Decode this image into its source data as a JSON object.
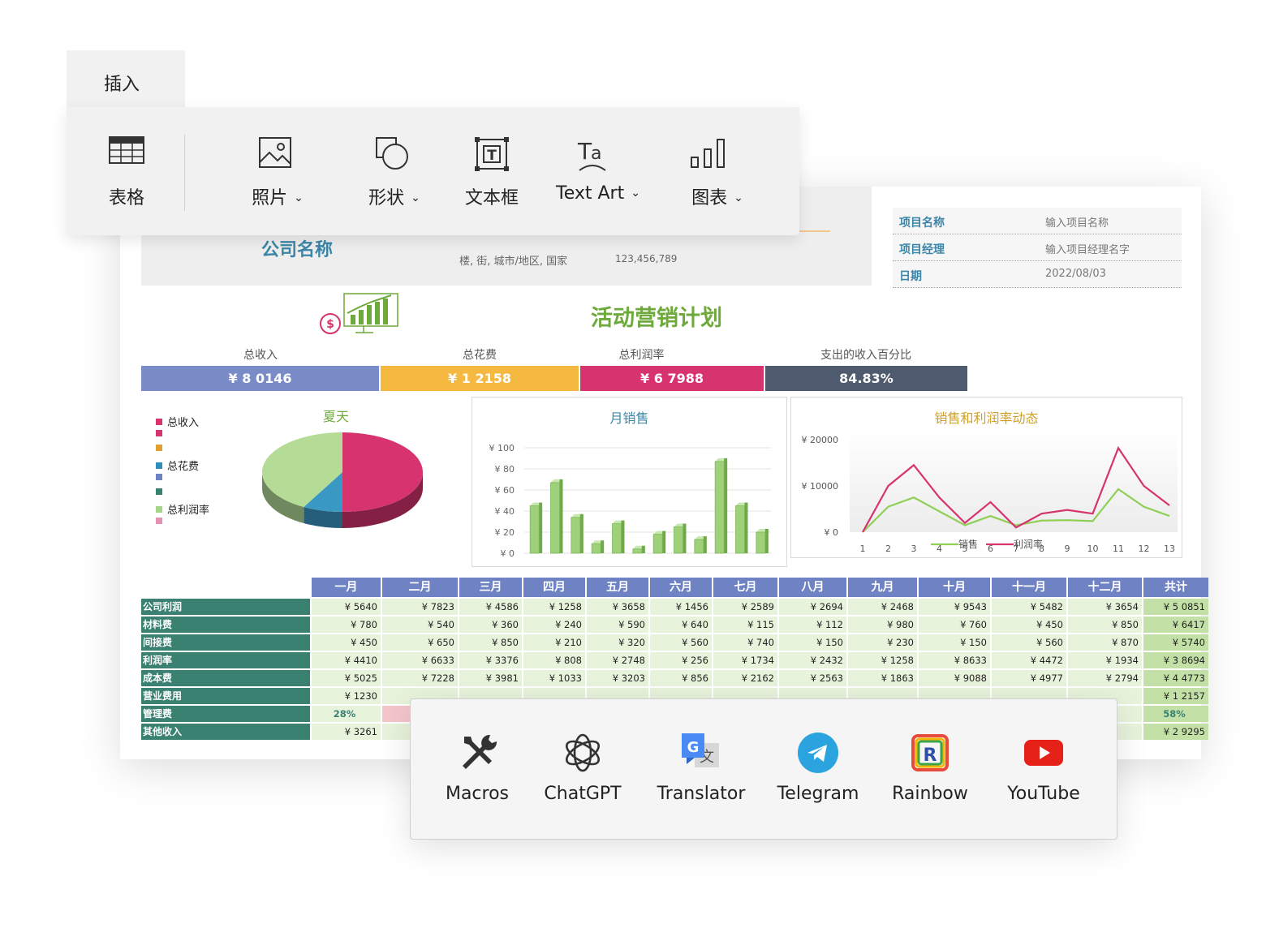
{
  "ribbon": {
    "tab": "插入",
    "tools": [
      {
        "label": "表格",
        "icon": "table-icon",
        "dropdown": false
      },
      {
        "label": "照片",
        "icon": "picture-icon",
        "dropdown": true
      },
      {
        "label": "形状",
        "icon": "shapes-icon",
        "dropdown": true
      },
      {
        "label": "文本框",
        "icon": "textbox-icon",
        "dropdown": false
      },
      {
        "label": "Text Art",
        "icon": "text-art-icon",
        "dropdown": true
      },
      {
        "label": "图表",
        "icon": "chart-icon",
        "dropdown": true
      }
    ],
    "caret": "⌄"
  },
  "sheet": {
    "company": "公司名称",
    "address": "楼, 街, 城市/地区, 国家",
    "phone": "123,456,789",
    "info": [
      {
        "key": "项目名称",
        "value": "输入项目名称"
      },
      {
        "key": "项目经理",
        "value": "输入项目经理名字"
      },
      {
        "key": "日期",
        "value": "2022/08/03"
      }
    ],
    "title": "活动营销计划",
    "kpis": [
      {
        "label": "总收入",
        "value": "¥ 8 0146",
        "color": "#7a8cc7"
      },
      {
        "label": "总花费",
        "value": "¥ 1 2158",
        "color": "#f5b942"
      },
      {
        "label": "总利润率",
        "value": "¥ 6 7988",
        "color": "#d6336f"
      },
      {
        "label": "支出的收入百分比",
        "value": "84.83%",
        "color": "#4e5a6d"
      }
    ],
    "months": [
      "一月",
      "二月",
      "三月",
      "四月",
      "五月",
      "六月",
      "七月",
      "八月",
      "九月",
      "十月",
      "十一月",
      "十二月",
      "共计"
    ],
    "rows": [
      {
        "label": "公司利润",
        "values": [
          "¥ 5640",
          "¥ 7823",
          "¥ 4586",
          "¥ 1258",
          "¥ 3658",
          "¥ 1456",
          "¥ 2589",
          "¥ 2694",
          "¥ 2468",
          "¥ 9543",
          "¥ 5482",
          "¥ 3654",
          "¥ 5 0851"
        ]
      },
      {
        "label": "材料费",
        "values": [
          "¥ 780",
          "¥ 540",
          "¥ 360",
          "¥ 240",
          "¥ 590",
          "¥ 640",
          "¥ 115",
          "¥ 112",
          "¥ 980",
          "¥ 760",
          "¥ 450",
          "¥ 850",
          "¥ 6417"
        ]
      },
      {
        "label": "间接费",
        "values": [
          "¥ 450",
          "¥ 650",
          "¥ 850",
          "¥ 210",
          "¥ 320",
          "¥ 560",
          "¥ 740",
          "¥ 150",
          "¥ 230",
          "¥ 150",
          "¥ 560",
          "¥ 870",
          "¥ 5740"
        ]
      },
      {
        "label": "利润率",
        "values": [
          "¥ 4410",
          "¥ 6633",
          "¥ 3376",
          "¥ 808",
          "¥ 2748",
          "¥ 256",
          "¥ 1734",
          "¥ 2432",
          "¥ 1258",
          "¥ 8633",
          "¥ 4472",
          "¥ 1934",
          "¥ 3 8694"
        ]
      },
      {
        "label": "成本费",
        "values": [
          "¥ 5025",
          "¥ 7228",
          "¥ 3981",
          "¥ 1033",
          "¥ 3203",
          "¥ 856",
          "¥ 2162",
          "¥ 2563",
          "¥ 1863",
          "¥ 9088",
          "¥ 4977",
          "¥ 2794",
          "¥ 4 4773"
        ]
      },
      {
        "label": "营业费用",
        "values": [
          "¥ 1230",
          "",
          "",
          "",
          "",
          "",
          "",
          "",
          "",
          "",
          "",
          "",
          "¥ 1 2157"
        ]
      },
      {
        "label": "管理费",
        "values": [
          "28%",
          "",
          "",
          "",
          "",
          "",
          "",
          "",
          "",
          "",
          "",
          "",
          "58%"
        ]
      },
      {
        "label": "其他收入",
        "values": [
          "¥ 3261",
          "",
          "",
          "",
          "",
          "",
          "",
          "",
          "",
          "",
          "",
          "",
          "¥ 2 9295"
        ]
      }
    ]
  },
  "chart_data": [
    {
      "type": "pie",
      "title": "夏天",
      "legend": [
        "总收入",
        "",
        "",
        "总花费",
        "",
        "",
        "总利润率",
        ""
      ],
      "legend_colors": [
        "#d6336f",
        "#d6336f",
        "#e0a030",
        "#2f8fba",
        "#6f83c4",
        "#3a8172",
        "#a6d48a",
        "#e690b2"
      ],
      "slices": [
        {
          "name": "总收入",
          "value": 50,
          "color": "#d6336f"
        },
        {
          "name": "总花费",
          "value": 8,
          "color": "#3a98c4"
        },
        {
          "name": "总利润率",
          "value": 42,
          "color": "#b4dc97"
        }
      ]
    },
    {
      "type": "bar",
      "title": "月销售",
      "y_ticks": [
        "¥ 0",
        "¥ 20",
        "¥ 40",
        "¥ 60",
        "¥ 80",
        "¥ 100"
      ],
      "ylim": [
        0,
        100
      ],
      "values": [
        45,
        67,
        34,
        9,
        28,
        4,
        18,
        25,
        13,
        87,
        45,
        20
      ],
      "color": "#9fd07a"
    },
    {
      "type": "line",
      "title": "销售和利润率动态",
      "y_ticks": [
        "¥ 0",
        "¥ 10000",
        "¥ 20000"
      ],
      "ylim": [
        0,
        20000
      ],
      "x": [
        1,
        2,
        3,
        4,
        5,
        6,
        7,
        8,
        9,
        10,
        11,
        12,
        13
      ],
      "x_labels": [
        "1",
        "2",
        "3",
        "4",
        "5",
        "6",
        "7",
        "8",
        "9",
        "10",
        "11",
        "12",
        "13"
      ],
      "series": [
        {
          "name": "销售",
          "color": "#8fcf55",
          "values": [
            0,
            5500,
            7500,
            4500,
            1500,
            3500,
            1500,
            2500,
            2600,
            2400,
            9300,
            5500,
            3500
          ]
        },
        {
          "name": "利润率",
          "color": "#d6336f",
          "values": [
            0,
            10000,
            14500,
            7500,
            2000,
            6500,
            1000,
            4000,
            4800,
            4000,
            18200,
            10000,
            5800
          ]
        }
      ]
    }
  ],
  "addins": [
    {
      "name": "Macros",
      "icon": "tools-icon"
    },
    {
      "name": "ChatGPT",
      "icon": "chatgpt-icon"
    },
    {
      "name": "Translator",
      "icon": "translate-icon"
    },
    {
      "name": "Telegram",
      "icon": "telegram-icon"
    },
    {
      "name": "Rainbow",
      "icon": "rainbow-icon"
    },
    {
      "name": "YouTube",
      "icon": "youtube-icon"
    }
  ]
}
